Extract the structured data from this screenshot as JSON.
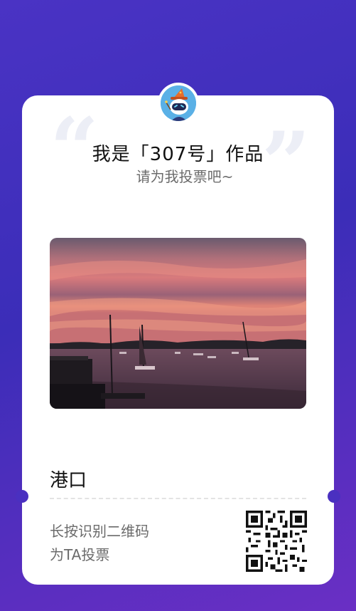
{
  "header": {
    "title": "我是「307号」作品",
    "subtitle": "请为我投票吧~"
  },
  "work": {
    "title": "港口"
  },
  "footer": {
    "hint_line1": "长按识别二维码",
    "hint_line2": "为TA投票"
  },
  "icons": {
    "avatar": "robot-wizard-avatar-icon",
    "open_quote": "open-quote-icon",
    "close_quote": "close-quote-icon",
    "qr": "qr-code-icon"
  },
  "colors": {
    "background_start": "#4a33c4",
    "background_end": "#6a2fc4",
    "card": "#ffffff",
    "title": "#111111",
    "secondary_text": "#6b6b6b"
  }
}
